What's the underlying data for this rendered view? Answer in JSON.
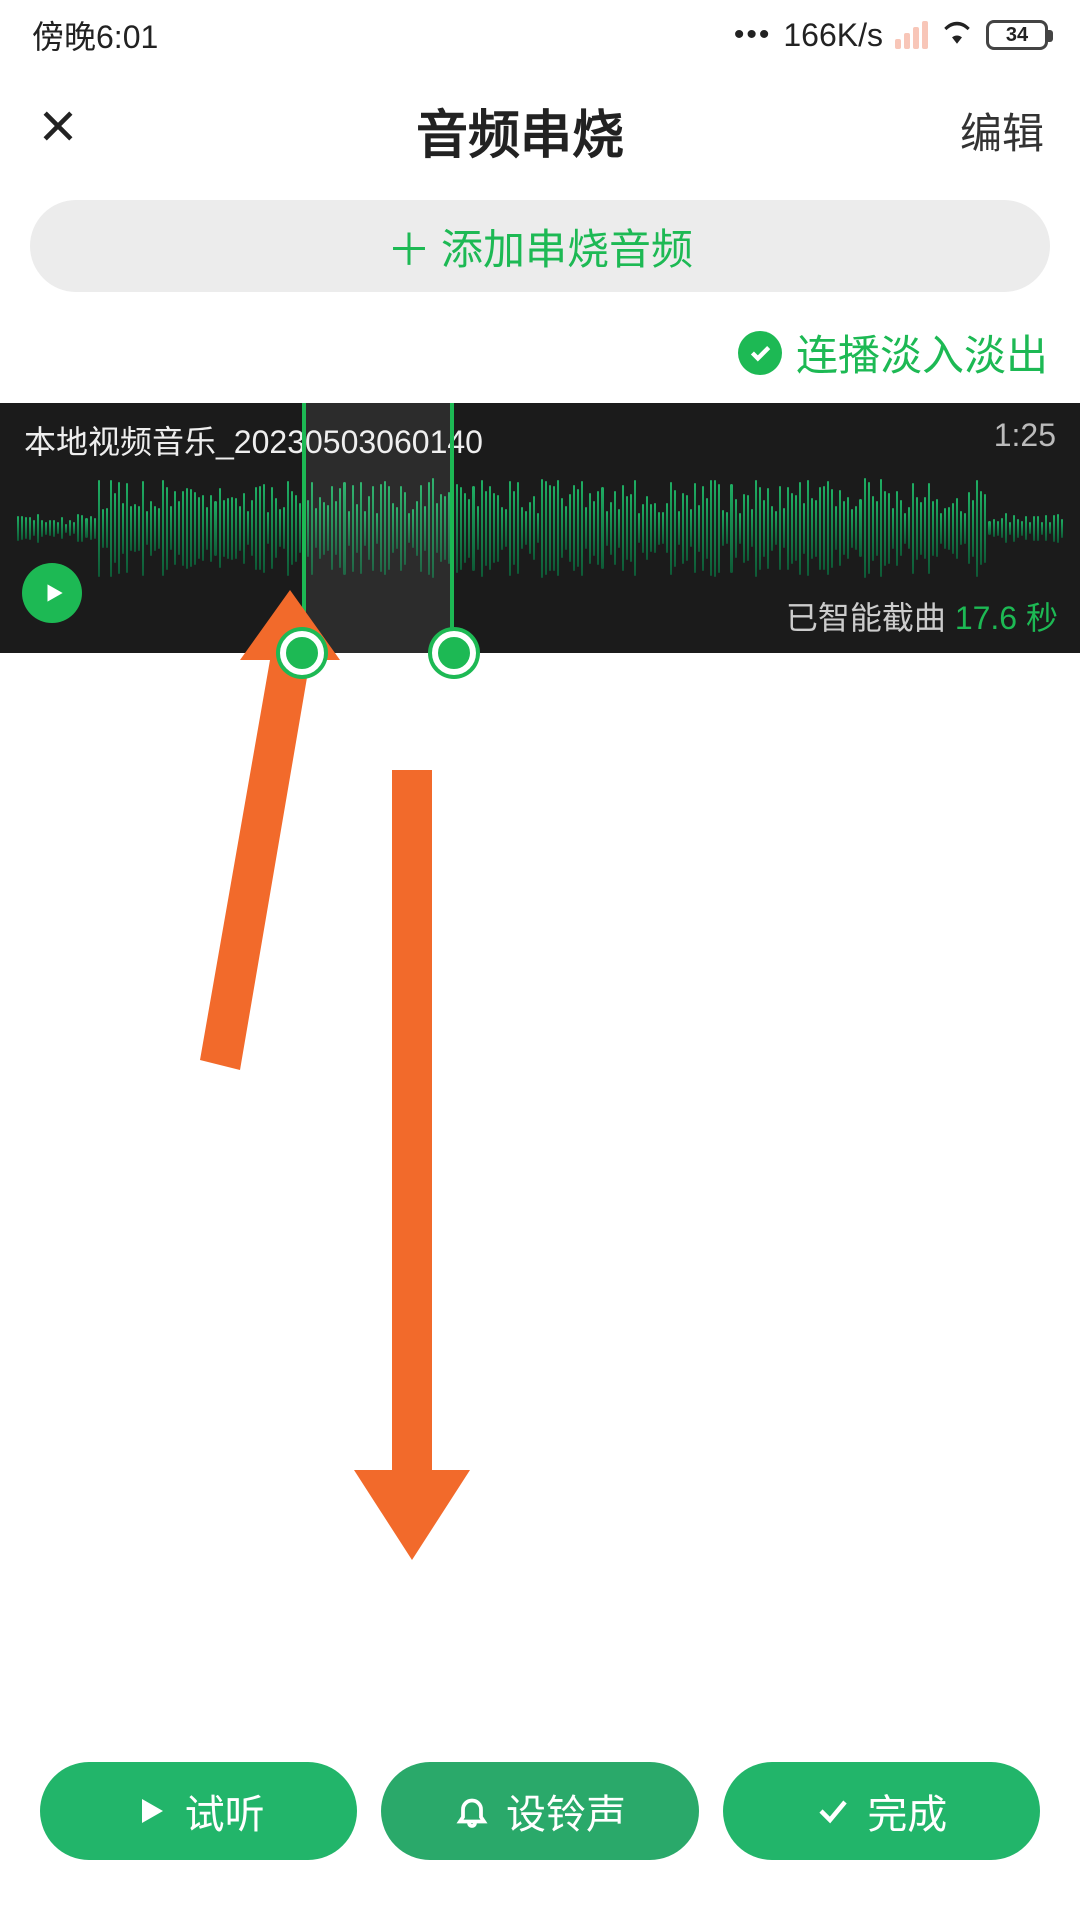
{
  "status": {
    "time": "傍晚6:01",
    "speed": "166K/s",
    "battery": "34"
  },
  "header": {
    "title": "音频串烧",
    "edit": "编辑"
  },
  "add_button_label": "添加串烧音频",
  "fade_toggle_label": "连播淡入淡出",
  "track": {
    "name": "本地视频音乐_20230503060140",
    "duration": "1:25",
    "clip_prefix": "已智能截曲",
    "clip_value": "17.6",
    "clip_unit": "秒",
    "selection_start_pct": 28,
    "selection_end_pct": 42
  },
  "buttons": {
    "preview": "试听",
    "set_ringtone": "设铃声",
    "done": "完成"
  },
  "colors": {
    "accent": "#1db954",
    "arrow": "#f26a2b"
  }
}
